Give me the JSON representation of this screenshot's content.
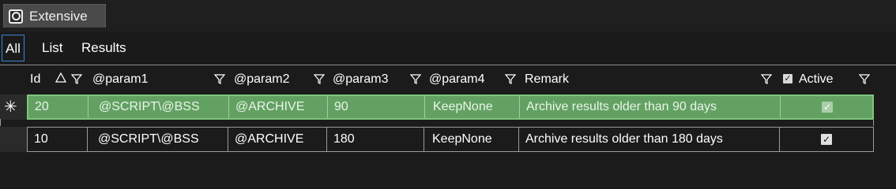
{
  "window": {
    "title": "Extensive",
    "icon": "circle-square-icon"
  },
  "subtabs": [
    {
      "label": "All",
      "active": true
    },
    {
      "label": "List",
      "active": false
    },
    {
      "label": "Results",
      "active": false
    }
  ],
  "grid": {
    "columns": [
      {
        "key": "id",
        "label": "Id",
        "sort": "ascending",
        "filter": true
      },
      {
        "key": "param1",
        "label": "@param1",
        "filter": true
      },
      {
        "key": "param2",
        "label": "@param2",
        "filter": true
      },
      {
        "key": "param3",
        "label": "@param3",
        "filter": true
      },
      {
        "key": "param4",
        "label": "@param4",
        "filter": true
      },
      {
        "key": "remark",
        "label": "Remark",
        "filter": true
      },
      {
        "key": "active",
        "label": "Active",
        "filter": true,
        "checkbox": true
      }
    ],
    "new_row": {
      "indicator": "✳",
      "id": "20",
      "param1": "@SCRIPT\\@BSS",
      "param2": "@ARCHIVE",
      "param3": "90",
      "param4": "KeepNone",
      "remark": "Archive results older than 90 days",
      "active": true
    },
    "rows": [
      {
        "id": "10",
        "param1": "@SCRIPT\\@BSS",
        "param2": "@ARCHIVE",
        "param3": "180",
        "param4": "KeepNone",
        "remark": "Archive results older than 180 days",
        "active": true
      }
    ]
  },
  "colors": {
    "background": "#1b1b1b",
    "new_row": "#63a163",
    "active_tab_border": "#3a86d8"
  }
}
